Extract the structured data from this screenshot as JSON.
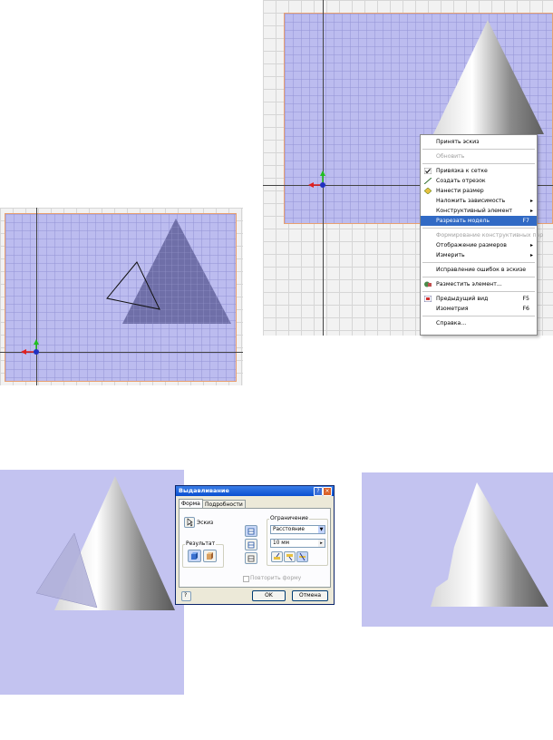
{
  "context_menu": {
    "items": [
      {
        "label": "Принять эскиз",
        "key": "",
        "state": "normal",
        "icon": ""
      },
      {
        "label": "Обновить",
        "key": "",
        "state": "disabled",
        "icon": ""
      },
      {
        "label": "Привязка к сетке",
        "key": "",
        "state": "checked",
        "icon": "check-icon"
      },
      {
        "label": "Создать отрезок",
        "key": "",
        "state": "normal",
        "icon": "line-icon"
      },
      {
        "label": "Нанести размер",
        "key": "",
        "state": "normal",
        "icon": "dimension-icon"
      },
      {
        "label": "Наложить зависимость",
        "key": "",
        "state": "submenu",
        "icon": ""
      },
      {
        "label": "Конструктивный элемент",
        "key": "",
        "state": "submenu",
        "icon": ""
      },
      {
        "label": "Разрезать модель",
        "key": "F7",
        "state": "selected",
        "icon": ""
      },
      {
        "label": "Формирование конструктивных пар",
        "key": "",
        "state": "disabled",
        "icon": ""
      },
      {
        "label": "Отображение размеров",
        "key": "",
        "state": "submenu",
        "icon": ""
      },
      {
        "label": "Измерить",
        "key": "",
        "state": "submenu",
        "icon": ""
      },
      {
        "label": "Исправление ошибок в эскизе",
        "key": "",
        "state": "normal",
        "icon": ""
      },
      {
        "label": "Разместить элемент...",
        "key": "",
        "state": "normal",
        "icon": "place-feature-icon"
      },
      {
        "label": "Предыдущий вид",
        "key": "F5",
        "state": "normal",
        "icon": "previous-view-icon"
      },
      {
        "label": "Изометрия",
        "key": "F6",
        "state": "normal",
        "icon": ""
      },
      {
        "label": "Справка...",
        "key": "",
        "state": "normal",
        "icon": ""
      }
    ]
  },
  "extrude_dialog": {
    "title": "Выдавливание",
    "tabs": [
      "Форма",
      "Подробности"
    ],
    "sketch_label": "Эскиз",
    "result_label": "Результат",
    "limit_label": "Ограничение",
    "limit_value": "Расстояние",
    "distance_value": "10 мм",
    "repeat_label": "Повторить форму",
    "ok_label": "OK",
    "cancel_label": "Отмена"
  },
  "colors": {
    "sketch_plane": "#c3c3f0",
    "selection": "#316ac5",
    "title_bar": "#0a4fd0",
    "axis_x": "#e02020",
    "axis_y": "#20c020",
    "origin": "#2030c0"
  }
}
